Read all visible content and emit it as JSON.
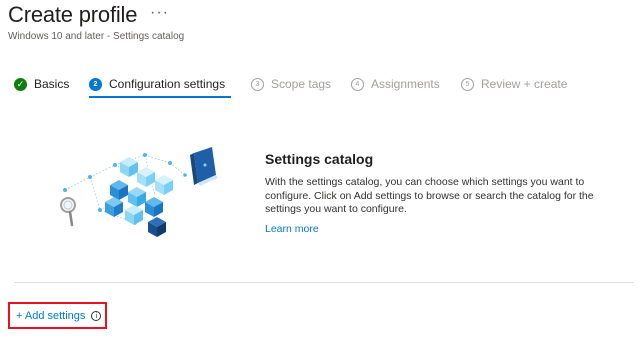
{
  "header": {
    "title": "Create profile",
    "more_label": "···",
    "subtitle": "Windows 10 and later - Settings catalog"
  },
  "steps": [
    {
      "number": "✓",
      "label": "Basics",
      "state": "done"
    },
    {
      "number": "2",
      "label": "Configuration settings",
      "state": "current"
    },
    {
      "number": "3",
      "label": "Scope tags",
      "state": "future"
    },
    {
      "number": "4",
      "label": "Assignments",
      "state": "future"
    },
    {
      "number": "5",
      "label": "Review + create",
      "state": "future"
    }
  ],
  "catalog": {
    "title": "Settings catalog",
    "description": "With the settings catalog, you can choose which settings you want to configure. Click on Add settings to browse or search the catalog for the settings you want to configure.",
    "learn_more": "Learn more"
  },
  "actions": {
    "add_settings": "+ Add settings",
    "info_icon": "i"
  },
  "colors": {
    "accent": "#0078d4",
    "done": "#107c10",
    "highlight": "#e81123"
  }
}
